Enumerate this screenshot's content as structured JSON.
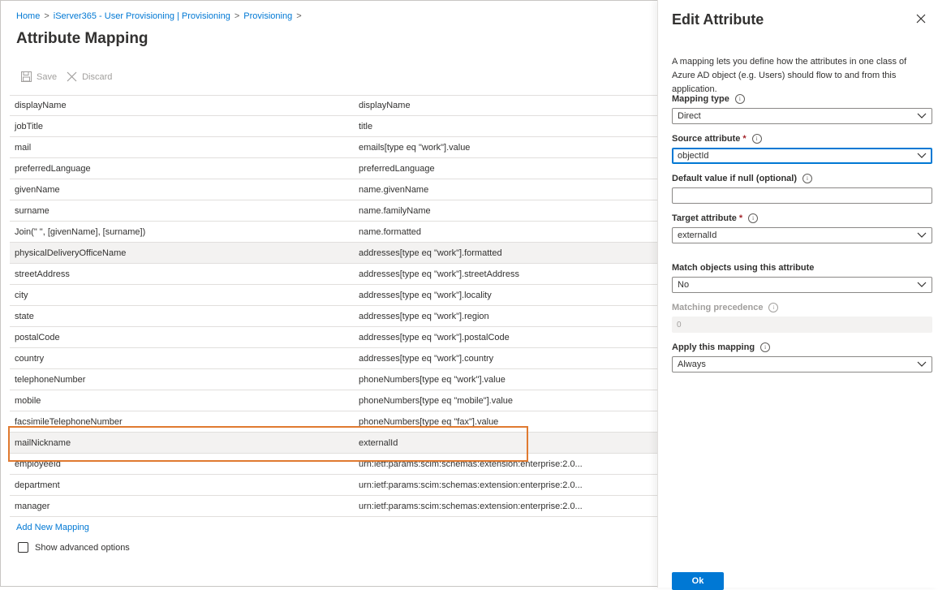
{
  "breadcrumb": [
    "Home",
    "iServer365 - User Provisioning | Provisioning",
    "Provisioning"
  ],
  "page_title": "Attribute Mapping",
  "toolbar": {
    "save_label": "Save",
    "discard_label": "Discard"
  },
  "mappings": [
    {
      "source": "displayName",
      "target": "displayName"
    },
    {
      "source": "jobTitle",
      "target": "title"
    },
    {
      "source": "mail",
      "target": "emails[type eq \"work\"].value"
    },
    {
      "source": "preferredLanguage",
      "target": "preferredLanguage"
    },
    {
      "source": "givenName",
      "target": "name.givenName"
    },
    {
      "source": "surname",
      "target": "name.familyName"
    },
    {
      "source": "Join(\" \", [givenName], [surname])",
      "target": "name.formatted"
    },
    {
      "source": "physicalDeliveryOfficeName",
      "target": "addresses[type eq \"work\"].formatted"
    },
    {
      "source": "streetAddress",
      "target": "addresses[type eq \"work\"].streetAddress"
    },
    {
      "source": "city",
      "target": "addresses[type eq \"work\"].locality"
    },
    {
      "source": "state",
      "target": "addresses[type eq \"work\"].region"
    },
    {
      "source": "postalCode",
      "target": "addresses[type eq \"work\"].postalCode"
    },
    {
      "source": "country",
      "target": "addresses[type eq \"work\"].country"
    },
    {
      "source": "telephoneNumber",
      "target": "phoneNumbers[type eq \"work\"].value"
    },
    {
      "source": "mobile",
      "target": "phoneNumbers[type eq \"mobile\"].value"
    },
    {
      "source": "facsimileTelephoneNumber",
      "target": "phoneNumbers[type eq \"fax\"].value"
    },
    {
      "source": "mailNickname",
      "target": "externalId"
    },
    {
      "source": "employeeId",
      "target": "urn:ietf:params:scim:schemas:extension:enterprise:2.0..."
    },
    {
      "source": "department",
      "target": "urn:ietf:params:scim:schemas:extension:enterprise:2.0..."
    },
    {
      "source": "manager",
      "target": "urn:ietf:params:scim:schemas:extension:enterprise:2.0..."
    }
  ],
  "add_mapping_label": "Add New Mapping",
  "show_advanced_label": "Show advanced options",
  "panel": {
    "title": "Edit Attribute",
    "description": "A mapping lets you define how the attributes in one class of Azure AD object (e.g. Users) should flow to and from this application.",
    "mapping_type": {
      "label": "Mapping type",
      "value": "Direct"
    },
    "source_attribute": {
      "label": "Source attribute",
      "value": "objectId"
    },
    "default_value": {
      "label": "Default value if null (optional)",
      "value": ""
    },
    "target_attribute": {
      "label": "Target attribute",
      "value": "externalId"
    },
    "match_objects": {
      "label": "Match objects using this attribute",
      "value": "No"
    },
    "matching_precedence": {
      "label": "Matching precedence",
      "value": "0"
    },
    "apply_mapping": {
      "label": "Apply this mapping",
      "value": "Always"
    },
    "required_mark": "*",
    "ok_label": "Ok"
  },
  "colors": {
    "accent": "#0078d4",
    "highlight": "#e07a30",
    "required": "#a4262c"
  }
}
